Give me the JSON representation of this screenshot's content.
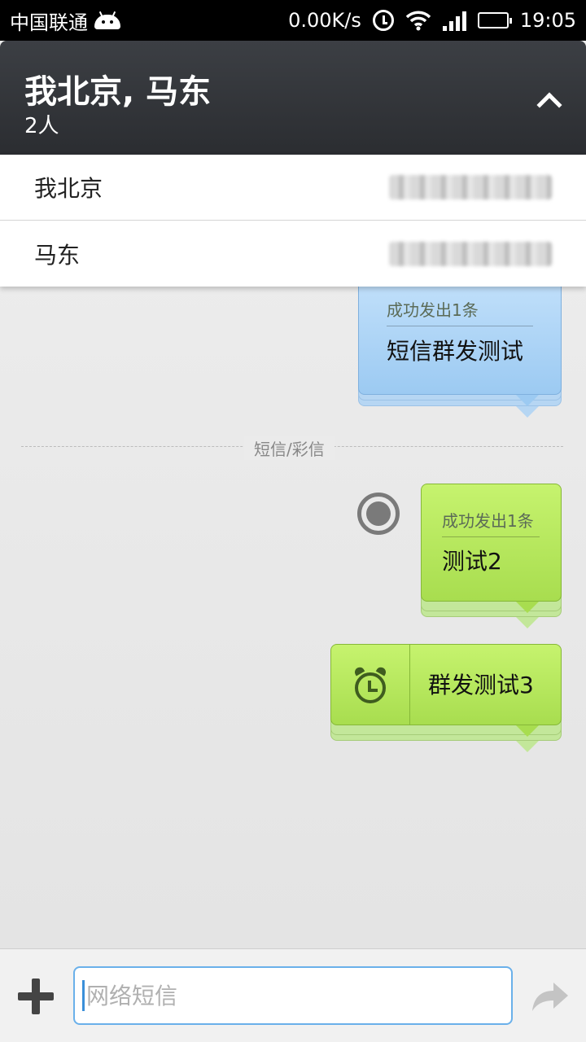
{
  "status_bar": {
    "carrier": "中国联通",
    "speed": "0.00K/s",
    "time": "19:05"
  },
  "header": {
    "title": "我北京, 马东",
    "subtitle": "2人"
  },
  "recipients": [
    {
      "name": "我北京"
    },
    {
      "name": "马东"
    }
  ],
  "messages": [
    {
      "status": "成功发出1条",
      "text": "短信群发测试",
      "color": "blue"
    },
    {
      "status": "成功发出1条",
      "text": "测试2",
      "color": "green"
    },
    {
      "text": "群发测试3",
      "color": "green",
      "scheduled": true
    }
  ],
  "divider": {
    "label": "短信/彩信"
  },
  "composer": {
    "placeholder": "网络短信"
  },
  "icons": {
    "add": "plus-icon",
    "send": "send-arrow-icon",
    "record": "record-icon",
    "alarm": "alarm-clock-icon",
    "collapse": "chevron-up-icon"
  },
  "colors": {
    "blue_bubble": "#9ccaf2",
    "green_bubble": "#a8dd4f",
    "accent": "#6ab0ea"
  }
}
